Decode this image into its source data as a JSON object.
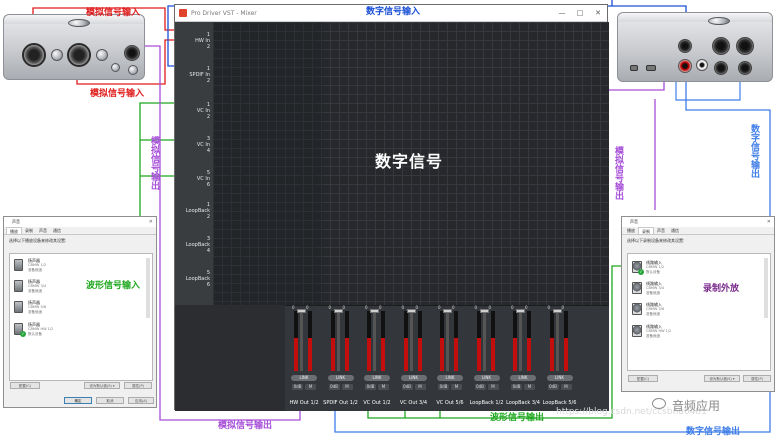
{
  "colors": {
    "analog": "#e01b1b",
    "digital": "#1a4fd6",
    "loopback": "#1fa81f",
    "analog_out": "#a64fd8",
    "analog_out_dark": "#7a2a8c",
    "digital_out": "#3f7de8"
  },
  "mixer": {
    "title": "Pro Driver VST - Mixer",
    "window_buttons": [
      "—",
      "□",
      "✕"
    ],
    "center_text": "数字信号",
    "input_labels": [
      {
        "n1": "1",
        "name": "HW In",
        "n2": "2"
      },
      {
        "n1": "1",
        "name": "SPDIF In",
        "n2": "2"
      },
      {
        "n1": "1",
        "name": "VC In",
        "n2": "2"
      },
      {
        "n1": "3",
        "name": "VC In",
        "n2": "4"
      },
      {
        "n1": "5",
        "name": "VC In",
        "n2": "6"
      },
      {
        "n1": "1",
        "name": "LoopBack",
        "n2": "2"
      },
      {
        "n1": "3",
        "name": "LoopBack",
        "n2": "4"
      },
      {
        "n1": "5",
        "name": "LoopBack",
        "n2": "6"
      }
    ],
    "outputs": [
      {
        "label": "HW Out  1/2",
        "link": "LINK",
        "btn1": "0dB",
        "btn2": "M",
        "level": 0.55
      },
      {
        "label": "SPDIF Out  1/2",
        "link": "LINK",
        "btn1": "0dB",
        "btn2": "M",
        "level": 0.55
      },
      {
        "label": "VC Out  1/2",
        "link": "LINK",
        "btn1": "0dB",
        "btn2": "M",
        "level": 0.55
      },
      {
        "label": "VC Out  3/4",
        "link": "LINK",
        "btn1": "0dB",
        "btn2": "M",
        "level": 0.55
      },
      {
        "label": "VC Out  5/6",
        "link": "LINK",
        "btn1": "0dB",
        "btn2": "M",
        "level": 0.55
      },
      {
        "label": "LoopBack 1/2",
        "link": "LINK",
        "btn1": "0dB",
        "btn2": "M",
        "level": 0.55
      },
      {
        "label": "LoopBack 3/4",
        "link": "LINK",
        "btn1": "0dB",
        "btn2": "M",
        "level": 0.55
      },
      {
        "label": "LoopBack 5/6",
        "link": "LINK",
        "btn1": "0dB",
        "btn2": "M",
        "level": 0.55
      }
    ],
    "peak_value": "0",
    "meter_ticks": "0\n-6\n-12\n-18\n-24\n-30\n-36\n-42\n-48"
  },
  "annotations": {
    "analog_in_top": "模拟信号输入",
    "analog_in_bottom": "模拟信号输入",
    "digital_in": "数字信号输入",
    "wave_in": "波形信号输入",
    "analog_out_left": "模拟信号输出",
    "analog_out_right": "模拟信号输出",
    "digital_out_right": "数字信号输出",
    "analog_out_bottom": "模拟信号输出",
    "wave_out": "波形信号输出",
    "digital_out_bottom": "数字信号输出",
    "record_external": "录制外放"
  },
  "left_dialog": {
    "title": "声音",
    "close": "✕",
    "tabs": [
      "播放",
      "录制",
      "声音",
      "通信"
    ],
    "hint": "选择以下播放设备来修改其设置:",
    "devices": [
      {
        "name": "扬声器",
        "sub": "CBMW 1/2",
        "state": "准备就绪"
      },
      {
        "name": "扬声器",
        "sub": "CBMW 3/4",
        "state": "准备就绪"
      },
      {
        "name": "扬声器",
        "sub": "CBMW 5/6",
        "state": "准备就绪"
      },
      {
        "name": "扬声器",
        "sub": "CBMW HW 1/2",
        "state": "默认设备"
      }
    ],
    "btn_configure": "配置(C)",
    "btn_default": "设为默认值(S) ▾",
    "btn_properties": "属性(P)",
    "ok": "确定",
    "cancel": "取消",
    "apply": "应用(A)"
  },
  "right_dialog": {
    "title": "声音",
    "close": "✕",
    "tabs": [
      "播放",
      "录制",
      "声音",
      "通信"
    ],
    "hint": "选择以下录制设备来修改其设置:",
    "devices": [
      {
        "name": "线路输入",
        "sub": "CBMW 1/2",
        "state": "默认设备"
      },
      {
        "name": "线路输入",
        "sub": "CBMW 3/4",
        "state": "准备就绪"
      },
      {
        "name": "线路输入",
        "sub": "CBMW 5/6",
        "state": "准备就绪"
      },
      {
        "name": "线路输入",
        "sub": "CBMW HW 1/2",
        "state": "准备就绪"
      }
    ],
    "btn_configure": "配置(C)",
    "btn_default": "设为默认值(S) ▾",
    "btn_properties": "属性(P)"
  },
  "watermark": {
    "brand": "音频应用",
    "url": "https://blog.csdn.net/ccsbnu0481"
  }
}
